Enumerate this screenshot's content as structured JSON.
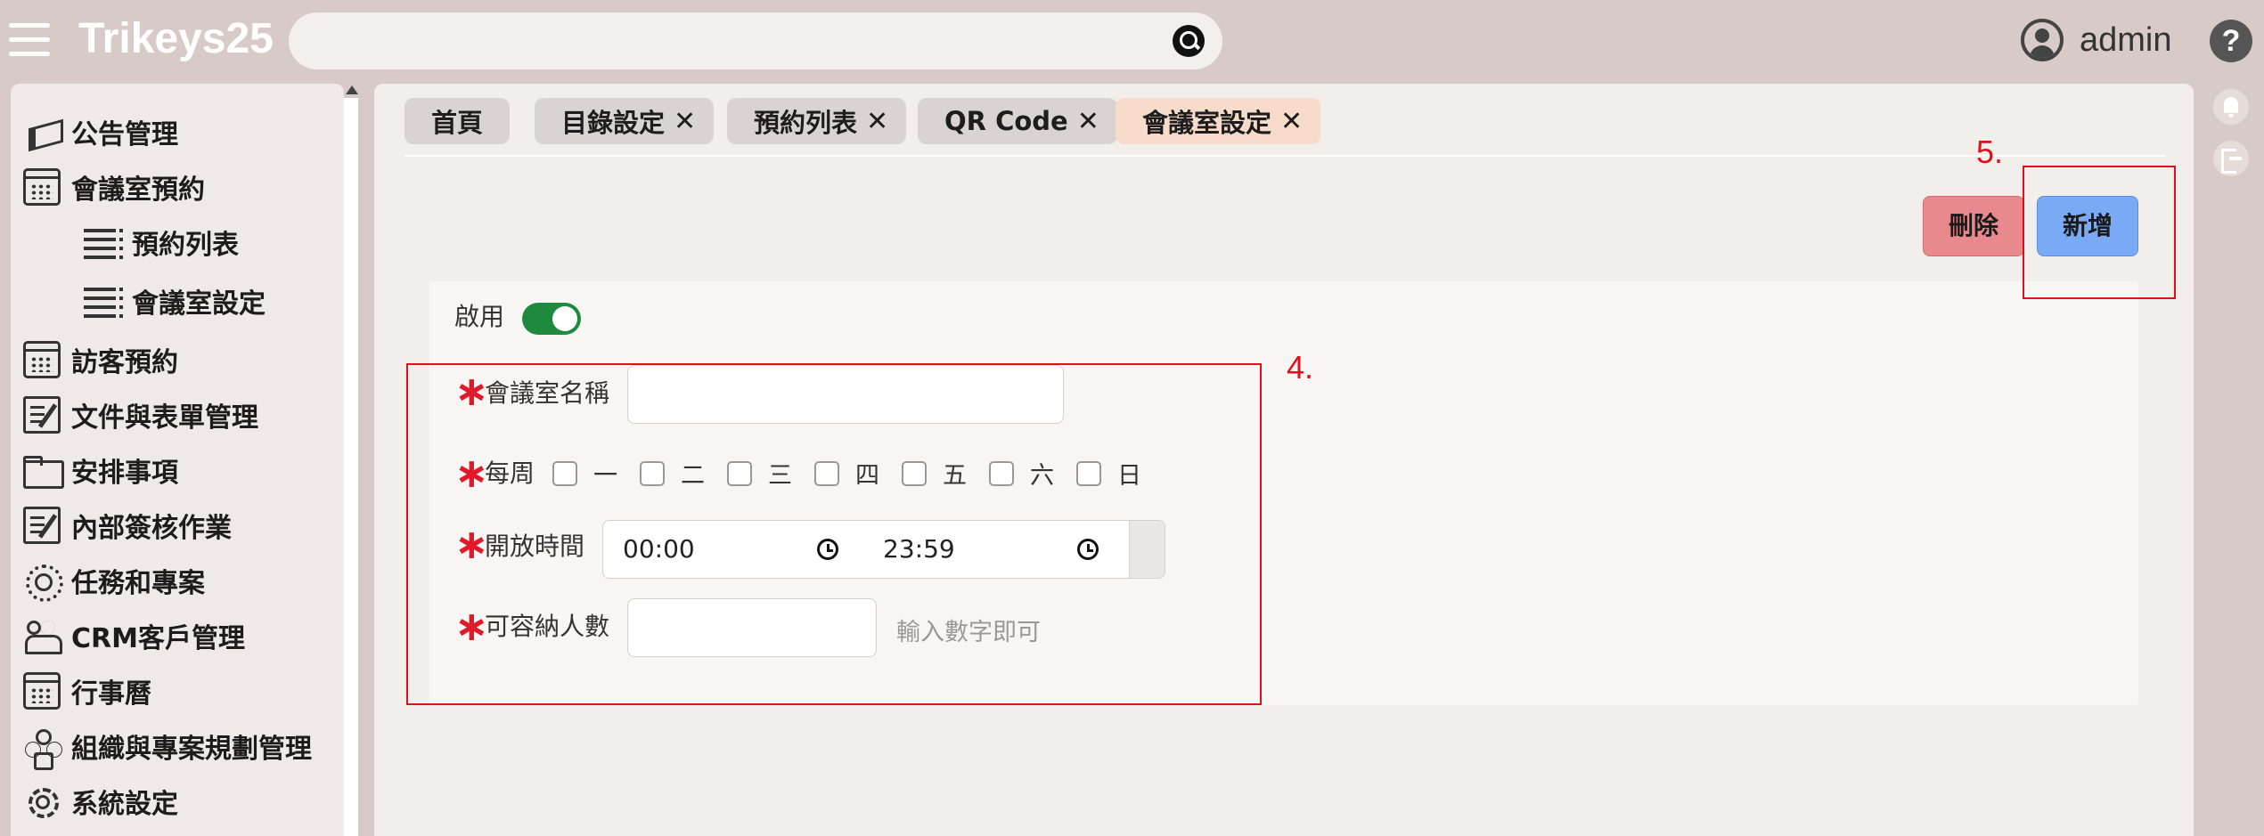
{
  "app": {
    "brand": "Trikeys25",
    "user": "admin",
    "help": "?"
  },
  "search": {
    "value": "",
    "placeholder": ""
  },
  "sidebar": {
    "items": [
      {
        "label": "公告管理",
        "icon": "megaphone-icon"
      },
      {
        "label": "會議室預約",
        "icon": "calendar-icon"
      },
      {
        "label": "預約列表",
        "icon": "list-icon"
      },
      {
        "label": "會議室設定",
        "icon": "list-icon"
      },
      {
        "label": "訪客預約",
        "icon": "calendar-icon"
      },
      {
        "label": "文件與表單管理",
        "icon": "document-edit-icon"
      },
      {
        "label": "安排事項",
        "icon": "folder-icon"
      },
      {
        "label": "內部簽核作業",
        "icon": "document-edit-icon"
      },
      {
        "label": "任務和專案",
        "icon": "gear-head-icon"
      },
      {
        "label": "CRM客戶管理",
        "icon": "people-icon"
      },
      {
        "label": "行事曆",
        "icon": "calendar-icon"
      },
      {
        "label": "組織與專案規劃管理",
        "icon": "org-chart-icon"
      },
      {
        "label": "系統設定",
        "icon": "gear-icon"
      }
    ]
  },
  "tabs": [
    {
      "label": "首頁",
      "closable": false
    },
    {
      "label": "目錄設定",
      "closable": true
    },
    {
      "label": "預約列表",
      "closable": true
    },
    {
      "label": "QR Code",
      "closable": true
    },
    {
      "label": "會議室設定",
      "closable": true,
      "active": true
    }
  ],
  "close_glyph": "✕",
  "actions": {
    "delete_label": "刪除",
    "add_label": "新增"
  },
  "annotations": {
    "form_marker": "4.",
    "add_marker": "5."
  },
  "form": {
    "enable_label": "啟用",
    "enabled": true,
    "required_mark": "∗",
    "room_name": {
      "label": "會議室名稱",
      "value": ""
    },
    "weekly": {
      "label": "每周",
      "days": [
        "一",
        "二",
        "三",
        "四",
        "五",
        "六",
        "日"
      ]
    },
    "open_time": {
      "label": "開放時間",
      "start": "00:00",
      "end": "23:59"
    },
    "capacity": {
      "label": "可容納人數",
      "value": "",
      "hint": "輸入數字即可"
    }
  },
  "colors": {
    "background": "#d8cbc7",
    "active_tab": "#f7dccb",
    "delete_button": "#e7898d",
    "add_button": "#7aaaf6",
    "toggle_on": "#1e8a3e",
    "annotation": "#e0101c"
  }
}
